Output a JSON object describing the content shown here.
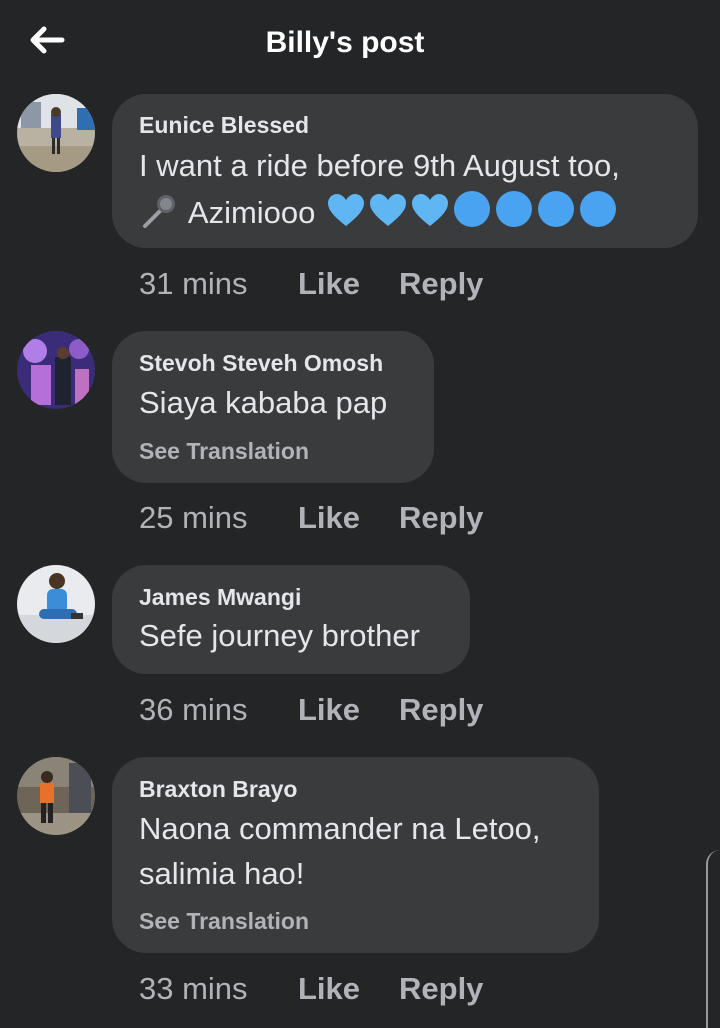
{
  "header": {
    "title": "Billy's post",
    "back_icon": "arrow-left-icon"
  },
  "comments": [
    {
      "name": "Eunice Blessed",
      "lines": [
        "I want a ride before 9th August  too,",
        "Azimiooo"
      ],
      "emoji": [
        "microphone",
        "blue-heart",
        "blue-heart",
        "blue-heart",
        "blue-circle",
        "blue-circle",
        "blue-circle",
        "blue-circle"
      ],
      "time": "31 mins",
      "like": "Like",
      "reply": "Reply"
    },
    {
      "name": "Stevoh Steveh Omosh",
      "lines": [
        "Siaya kababa  pap"
      ],
      "translate": "See Translation",
      "time": "25 mins",
      "like": "Like",
      "reply": "Reply"
    },
    {
      "name": "James Mwangi",
      "lines": [
        "Sefe journey brother"
      ],
      "time": "36 mins",
      "like": "Like",
      "reply": "Reply"
    },
    {
      "name": "Braxton Brayo",
      "lines": [
        "Naona commander na Letoo,",
        "salimia hao!"
      ],
      "translate": "See Translation",
      "time": "33 mins",
      "like": "Like",
      "reply": "Reply"
    }
  ],
  "colors": {
    "background": "#242526",
    "bubble": "#3a3b3c",
    "text": "#e4e6eb",
    "secondary": "#b0b3b8",
    "blue": "#2d88ff"
  }
}
